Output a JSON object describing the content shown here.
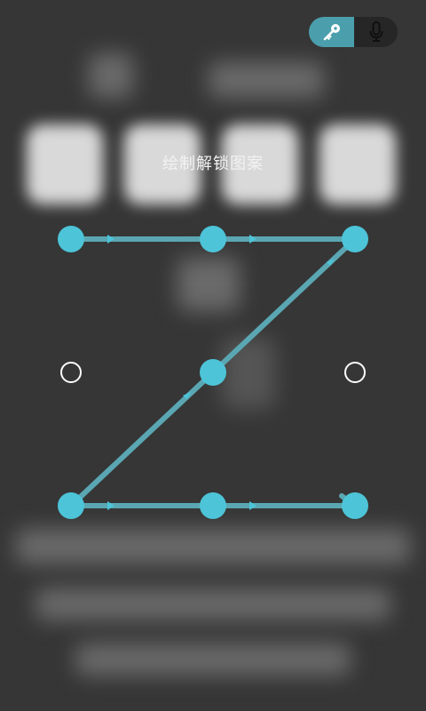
{
  "lock_screen": {
    "hint_text": "绘制解锁图案",
    "toggle": {
      "active_mode": "key",
      "key_icon": "key-icon",
      "mic_icon": "microphone-icon"
    },
    "pattern": {
      "grid_size": 3,
      "selected_dots": [
        1,
        2,
        3,
        5,
        7,
        8,
        9
      ],
      "unselected_dots": [
        4,
        6
      ],
      "path_order": [
        1,
        2,
        3,
        5,
        7,
        8,
        9
      ]
    },
    "colors": {
      "background": "#363636",
      "dot_selected": "#4dc4d8",
      "path_line": "#5aa7b3",
      "dot_unselected_ring": "#ffffff",
      "toggle_active": "#4b9fad"
    }
  }
}
